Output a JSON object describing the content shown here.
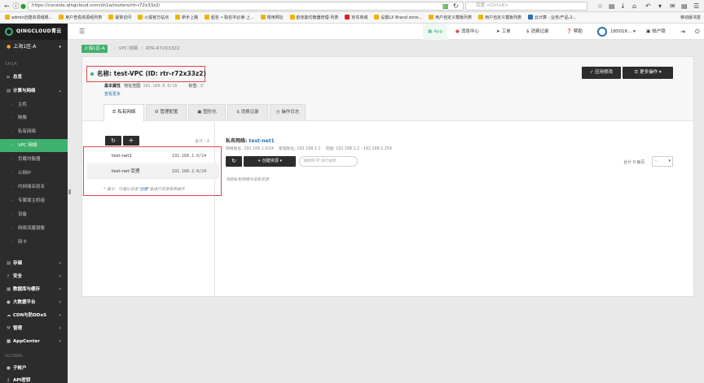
{
  "browser": {
    "url": "https://console.qingcloud.com/sh1a/routers/rtr-r72x33z2/",
    "search_placeholder": "百度 <Ctrl+K>",
    "bookmarks": [
      "admin创建资源组概...",
      "用户查看资源组列表",
      "最常访问",
      "火狐官方站点",
      "新手上路",
      "起名 • 取名字必读-上...",
      "常用网址",
      "欧克能均衡器管理-列表",
      "京东商城",
      "设置LX Brand zone...",
      "用户自定义模板列表",
      "用户自定义模板列表",
      "云计算 - 业务/产品-2..."
    ],
    "bookmarks_right": "移动版书签"
  },
  "sidebar": {
    "logo": "QINGCLOUD青云",
    "zone": "上海1区-A",
    "section_region": "SH1A",
    "section_global": "GLOBAL",
    "items": {
      "overview": "总览",
      "compute": "计算与网络",
      "storage": "存储",
      "security": "安全",
      "database": "数据库与缓存",
      "bigdata": "大数据平台",
      "cdn": "CDN与防DDoS",
      "manage": "管理",
      "appcenter": "AppCenter",
      "subaccount": "子帐户",
      "apikey": "API密钥"
    },
    "sub_items": [
      "主机",
      "映像",
      "私有网络",
      "VPC 网络",
      "负载均衡器",
      "公网IP",
      "内网域名别名",
      "专属宿主机组",
      "设备",
      "网络流量镜像",
      "网卡"
    ]
  },
  "appbar": {
    "app": "App",
    "messages": "消息中心",
    "tickets": "工单",
    "bills": "消费记录",
    "help": "帮助",
    "user": "185016...",
    "account": "帐户锁"
  },
  "breadcrumb": {
    "zone": "上海1区-A",
    "vpc": "VPC 网络",
    "id": "RTR-R72X33Z2"
  },
  "header": {
    "name": "名称: test-VPC (ID: rtr-r72x33z2)",
    "basic_props_label": "基本属性",
    "addr_range_label": "地址范围",
    "addr_range": "192.168.0.0/16",
    "tags_label": "标签",
    "tags_value": "无",
    "more_link": "查看更多",
    "apply_button": "应用修改",
    "more_ops_button": "更多操作"
  },
  "tabs": [
    "私有网络",
    "管理配置",
    "图形化",
    "消费记录",
    "操作日志"
  ],
  "subnets": {
    "total": "合计 : 2",
    "rows": [
      {
        "name": "test-net1",
        "cidr": "192.168.1.0/24"
      },
      {
        "name": "test-net-受理",
        "cidr": "192.168.2.0/24"
      }
    ],
    "tip_prefix": "* 提示：可通过点击\"",
    "tip_link": "创建",
    "tip_suffix": "\"来进行资源常用操作"
  },
  "detail": {
    "title_prefix": "私有网络:",
    "title_link": "test-net1",
    "network_addr": "网络地址: 192.168.1.0/24",
    "mgmt_addr": "管理地址: 192.168.1.1",
    "range": "范围: 192.168.1.2 - 192.168.1.254",
    "create_button": "创建资源",
    "ip_search_placeholder": "请使用 IP 进行搜索",
    "pager": "合计 0 每页",
    "page_size": "-",
    "empty": "当前私有网络中没有资源"
  }
}
